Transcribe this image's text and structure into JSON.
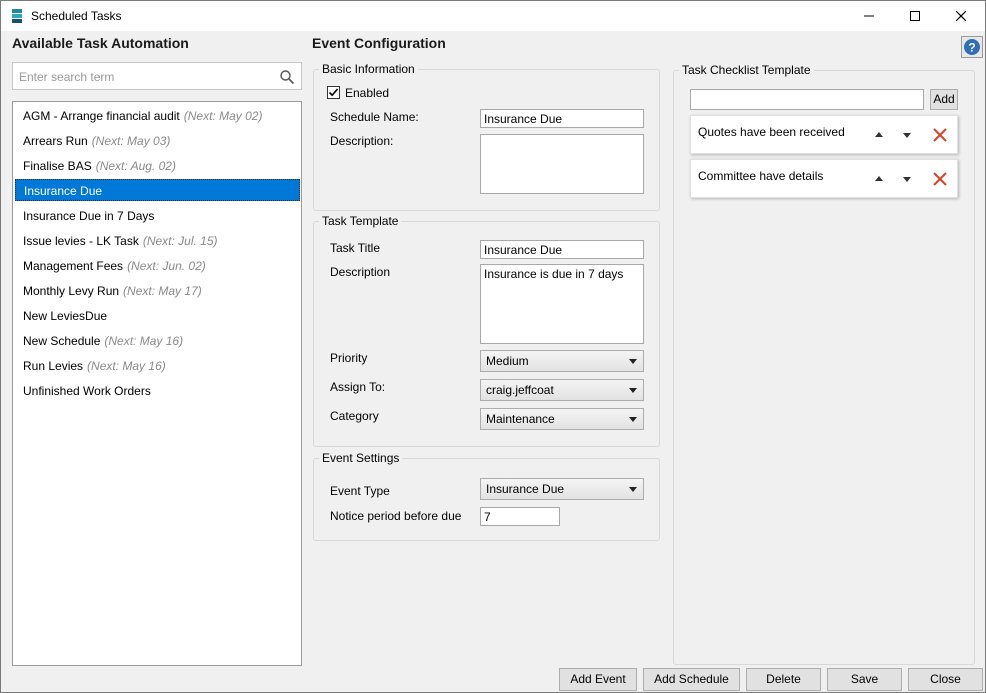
{
  "window": {
    "title": "Scheduled Tasks"
  },
  "left": {
    "heading": "Available Task Automation",
    "search_placeholder": "Enter search term",
    "tasks": [
      {
        "name": "AGM - Arrange financial audit",
        "next": "(Next: May 02)"
      },
      {
        "name": "Arrears Run",
        "next": "(Next: May 03)"
      },
      {
        "name": "Finalise BAS",
        "next": "(Next: Aug. 02)"
      },
      {
        "name": "Insurance Due",
        "next": ""
      },
      {
        "name": "Insurance Due in 7 Days",
        "next": ""
      },
      {
        "name": "Issue levies - LK Task",
        "next": "(Next: Jul. 15)"
      },
      {
        "name": "Management Fees",
        "next": "(Next: Jun. 02)"
      },
      {
        "name": "Monthly Levy Run",
        "next": "(Next: May 17)"
      },
      {
        "name": "New LeviesDue",
        "next": ""
      },
      {
        "name": "New Schedule",
        "next": "(Next: May 16)"
      },
      {
        "name": "Run Levies",
        "next": "(Next: May 16)"
      },
      {
        "name": "Unfinished Work Orders",
        "next": ""
      }
    ],
    "selected_index": 3
  },
  "config": {
    "heading": "Event Configuration",
    "basic": {
      "legend": "Basic Information",
      "enabled_label": "Enabled",
      "enabled": true,
      "schedule_name_label": "Schedule Name:",
      "schedule_name_value": "Insurance Due",
      "description_label": "Description:",
      "description_value": ""
    },
    "template": {
      "legend": "Task Template",
      "title_label": "Task Title",
      "title_value": "Insurance Due",
      "description_label": "Description",
      "description_value": "Insurance is due in 7 days",
      "priority_label": "Priority",
      "priority_value": "Medium",
      "assign_label": "Assign To:",
      "assign_value": "craig.jeffcoat",
      "category_label": "Category",
      "category_value": "Maintenance"
    },
    "event": {
      "legend": "Event Settings",
      "type_label": "Event Type",
      "type_value": "Insurance Due",
      "notice_label": "Notice period before due",
      "notice_value": "7"
    }
  },
  "checklist": {
    "legend": "Task Checklist Template",
    "input_value": "",
    "add_label": "Add",
    "items": [
      {
        "text": "Quotes have been received"
      },
      {
        "text": "Committee have details"
      }
    ]
  },
  "buttons": {
    "add_event": "Add Event",
    "add_schedule": "Add Schedule",
    "delete": "Delete",
    "save": "Save",
    "close": "Close"
  },
  "colors": {
    "selection": "#0078d7",
    "delete_icon": "#d9442a",
    "help_icon": "#2f6fb7"
  }
}
